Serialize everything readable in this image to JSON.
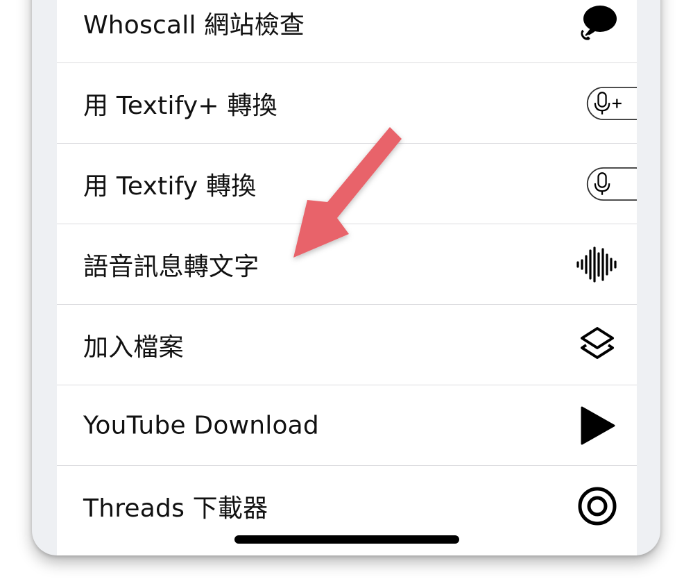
{
  "shortcuts": [
    {
      "label": "Whoscall 網站檢查",
      "icon": "speech-bubble-phone-icon"
    },
    {
      "label": "用 Textify+ 轉換",
      "icon": "microphone-plus-icon"
    },
    {
      "label": "用 Textify 轉換",
      "icon": "microphone-icon"
    },
    {
      "label": "語音訊息轉文字",
      "icon": "waveform-icon"
    },
    {
      "label": "加入檔案",
      "icon": "layers-icon"
    },
    {
      "label": "YouTube Download",
      "icon": "play-icon"
    },
    {
      "label": "Threads 下載器",
      "icon": "target-circle-icon"
    }
  ],
  "annotation": {
    "color": "#e8646a",
    "icon": "annotation-arrow"
  }
}
